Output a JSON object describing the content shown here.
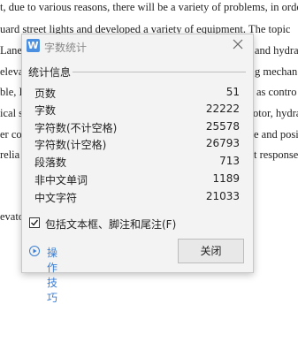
{
  "background_doc": {
    "line1": "t, due to various reasons, there will be a variety of problems, in orde",
    "line2": "uard street  lights and developed a variety of equipment. The topic",
    "frag_lane": "Lane",
    "frag_hydra1": "and hydra",
    "frag_eleva": "eleva",
    "frag_mechan": "g mechan",
    "frag_ble": "ble, I",
    "frag_contro": "as contro",
    "frag_ical": "ical s",
    "frag_hydra2": "otor, hydra",
    "frag_er": "er co",
    "frag_posit": "e and posit",
    "frag_relia": "relia",
    "frag_response": "t response",
    "frag_evato": "evato"
  },
  "dialog": {
    "title": "字数统计",
    "app_icon_letter": "W",
    "group_title": "统计信息",
    "stats": [
      {
        "label": "页数",
        "value": "51"
      },
      {
        "label": "字数",
        "value": "22222"
      },
      {
        "label": "字符数(不计空格)",
        "value": "25578"
      },
      {
        "label": "字符数(计空格)",
        "value": "26793"
      },
      {
        "label": "段落数",
        "value": "713"
      },
      {
        "label": "非中文单词",
        "value": "1189"
      },
      {
        "label": "中文字符",
        "value": "21033"
      }
    ],
    "checkbox_label": "包括文本框、脚注和尾注(F)",
    "checkbox_checked": true,
    "tips_label": "操作技巧",
    "close_button_label": "关闭"
  },
  "colors": {
    "accent": "#3b7fd4",
    "dialog_bg": "#f3f3f3",
    "app_icon": "#4a8fe0"
  }
}
